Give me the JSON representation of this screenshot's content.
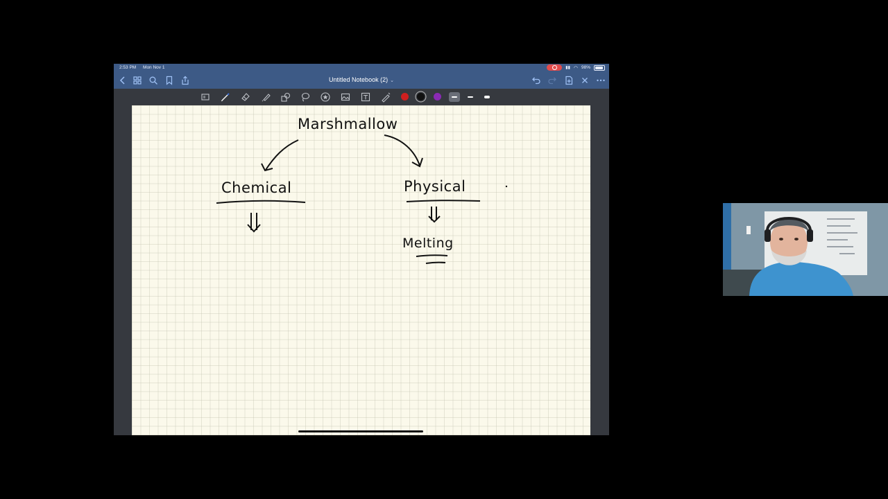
{
  "status_bar": {
    "time": "2:53 PM",
    "date": "Mon Nov 1",
    "battery": "98%"
  },
  "nav_bar": {
    "title": "Untitled Notebook (2)",
    "left_icons": [
      "back-chevron-icon",
      "grid-icon",
      "search-icon",
      "bookmark-icon",
      "share-icon"
    ],
    "right_icons": [
      "undo-icon",
      "redo-icon",
      "add-page-icon",
      "close-icon",
      "more-icon"
    ]
  },
  "toolbar": {
    "tools": [
      "read-mode-icon",
      "pen-icon",
      "eraser-icon",
      "highlighter-icon",
      "shapes-icon",
      "lasso-icon",
      "sticker-icon",
      "image-icon",
      "text-icon",
      "laser-pointer-icon"
    ],
    "selected_tool": "pen-icon",
    "colors": [
      "#cf1f1f",
      "#111111",
      "#8b2ab5"
    ],
    "selected_color": "#111111",
    "thickness_options": 3,
    "selected_thickness": 1
  },
  "note": {
    "title_word": "Marshmallow",
    "left_branch": "Chemical",
    "right_branch": "Physical",
    "right_example": "Melting"
  }
}
